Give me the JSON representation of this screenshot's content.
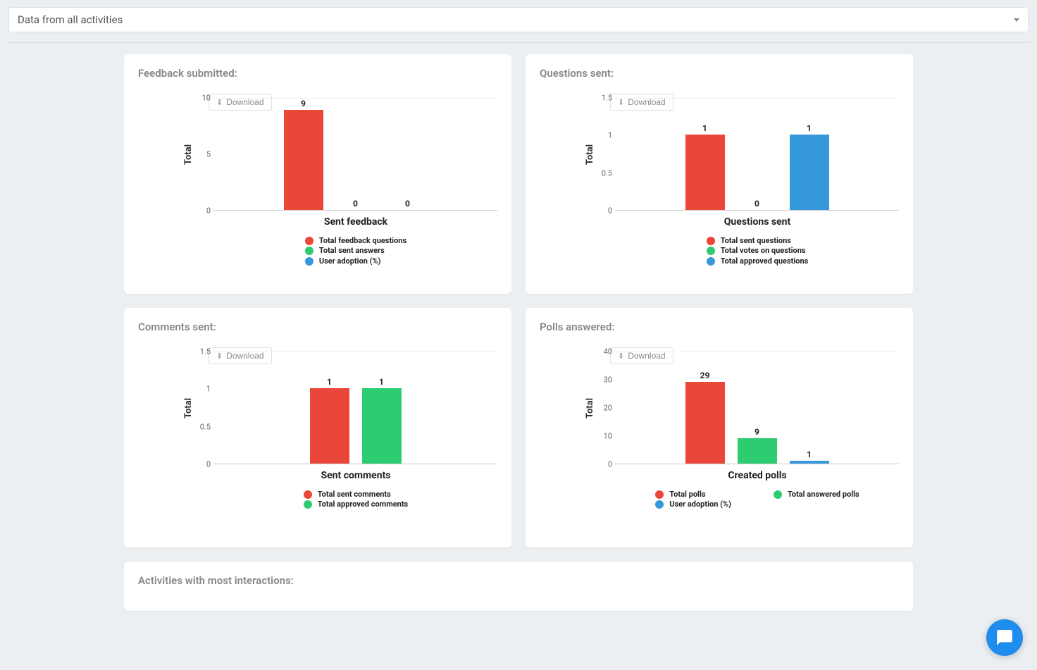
{
  "dropdown": {
    "selected": "Data from all activities"
  },
  "download_label": "Download",
  "colors": {
    "red": "#ea4639",
    "green": "#2ecc71",
    "blue": "#3498db"
  },
  "cards": {
    "feedback": {
      "title": "Feedback submitted:"
    },
    "questions": {
      "title": "Questions sent:"
    },
    "comments": {
      "title": "Comments sent:"
    },
    "polls": {
      "title": "Polls answered:"
    },
    "activities": {
      "title": "Activities with most interactions:"
    }
  },
  "chart_data": [
    {
      "id": "feedback",
      "type": "bar",
      "title": "",
      "xlabel": "Sent feedback",
      "ylabel": "Total",
      "ylim": [
        0,
        10
      ],
      "yticks": [
        0,
        5,
        10
      ],
      "series": [
        {
          "name": "Total feedback questions",
          "color": "red",
          "value": 9
        },
        {
          "name": "Total sent answers",
          "color": "green",
          "value": 0
        },
        {
          "name": "User adoption (%)",
          "color": "blue",
          "value": 0
        }
      ],
      "legend_layout": "single"
    },
    {
      "id": "questions",
      "type": "bar",
      "title": "",
      "xlabel": "Questions sent",
      "ylabel": "Total",
      "ylim": [
        0,
        1.5
      ],
      "yticks": [
        0,
        0.5,
        1,
        1.5
      ],
      "series": [
        {
          "name": "Total sent questions",
          "color": "red",
          "value": 1
        },
        {
          "name": "Total votes on questions",
          "color": "green",
          "value": 0
        },
        {
          "name": "Total approved questions",
          "color": "blue",
          "value": 1
        }
      ],
      "legend_layout": "single"
    },
    {
      "id": "comments",
      "type": "bar",
      "title": "",
      "xlabel": "Sent comments",
      "ylabel": "Total",
      "ylim": [
        0,
        1.5
      ],
      "yticks": [
        0,
        0.5,
        1,
        1.5
      ],
      "series": [
        {
          "name": "Total sent comments",
          "color": "red",
          "value": 1
        },
        {
          "name": "Total approved comments",
          "color": "green",
          "value": 1
        }
      ],
      "legend_layout": "single"
    },
    {
      "id": "polls",
      "type": "bar",
      "title": "",
      "xlabel": "Created polls",
      "ylabel": "Total",
      "ylim": [
        0,
        40
      ],
      "yticks": [
        0,
        10,
        20,
        30,
        40
      ],
      "series": [
        {
          "name": "Total polls",
          "color": "red",
          "value": 29
        },
        {
          "name": "Total answered polls",
          "color": "green",
          "value": 9
        },
        {
          "name": "User adoption (%)",
          "color": "blue",
          "value": 1
        }
      ],
      "legend_layout": "two-col",
      "legend_cols": [
        [
          {
            "name": "Total polls",
            "color": "red"
          },
          {
            "name": "User adoption (%)",
            "color": "blue"
          }
        ],
        [
          {
            "name": "Total answered polls",
            "color": "green"
          }
        ]
      ]
    }
  ]
}
